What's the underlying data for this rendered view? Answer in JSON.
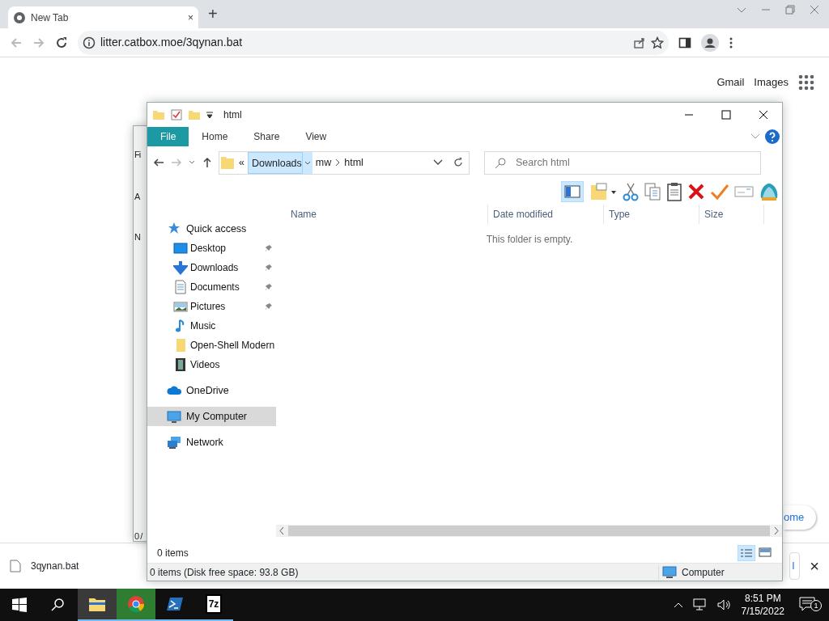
{
  "browser": {
    "tab": {
      "title": "New Tab",
      "close": "×"
    },
    "new_tab": "+",
    "address": "litter.catbox.moe/3qynan.bat",
    "links": [
      "Gmail",
      "Images"
    ],
    "partial_button": "ome",
    "download": {
      "filename": "3qynan.bat",
      "partial_button": "l",
      "close": "×"
    }
  },
  "back_window": {
    "fragments": [
      "Fi",
      "A",
      "N",
      "0 /"
    ]
  },
  "explorer": {
    "title": "html",
    "ribbon_tabs": [
      {
        "label": "File",
        "selected": true
      },
      {
        "label": "Home",
        "selected": false
      },
      {
        "label": "Share",
        "selected": false
      },
      {
        "label": "View",
        "selected": false
      }
    ],
    "breadcrumb": [
      {
        "label": "«",
        "selected": false
      },
      {
        "label": "Downloads",
        "selected": true
      },
      {
        "label": "mw",
        "selected": false
      },
      {
        "label": "html",
        "selected": false
      }
    ],
    "search": {
      "placeholder": "Search html"
    },
    "columns": [
      "Name",
      "Date modified",
      "Type",
      "Size"
    ],
    "empty_message": "This folder is empty.",
    "nav": [
      {
        "label": "Quick access",
        "selected": false,
        "children": [
          {
            "label": "Desktop",
            "pinned": true
          },
          {
            "label": "Downloads",
            "pinned": true
          },
          {
            "label": "Documents",
            "pinned": true
          },
          {
            "label": "Pictures",
            "pinned": true
          },
          {
            "label": "Music",
            "pinned": false
          },
          {
            "label": "Open-Shell Modern",
            "pinned": false
          },
          {
            "label": "Videos",
            "pinned": false
          }
        ]
      },
      {
        "label": "OneDrive",
        "selected": false
      },
      {
        "label": "My Computer",
        "selected": true
      },
      {
        "label": "Network",
        "selected": false
      }
    ],
    "item_count": "0 items",
    "status": "0 items (Disk free space: 93.8 GB)",
    "status_location": "Computer"
  },
  "taskbar": {
    "apps": [
      {
        "kind": "explorer",
        "active": true
      },
      {
        "kind": "chrome",
        "active": false
      },
      {
        "kind": "powershell",
        "active": false
      },
      {
        "kind": "sevenzip",
        "active": false
      }
    ],
    "sevenzip_label": "7z",
    "time": "8:51 PM",
    "date": "7/15/2022",
    "notifications": "1"
  }
}
